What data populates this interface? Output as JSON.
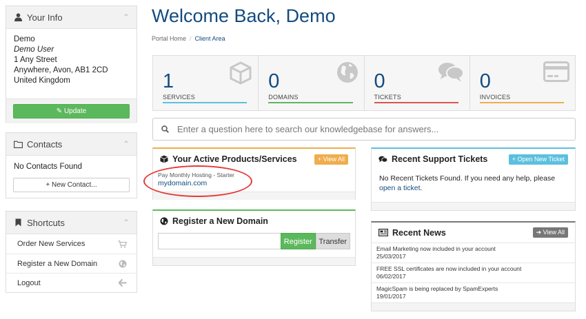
{
  "your_info": {
    "title": "Your Info",
    "name": "Demo",
    "user": "Demo User",
    "address1": "1 Any Street",
    "address2": "Anywhere, Avon, AB1 2CD",
    "country": "United Kingdom",
    "update_label": "Update"
  },
  "contacts": {
    "title": "Contacts",
    "empty_text": "No Contacts Found",
    "new_label": "New Contact..."
  },
  "shortcuts": {
    "title": "Shortcuts",
    "items": [
      {
        "label": "Order New Services",
        "icon": "cart-icon"
      },
      {
        "label": "Register a New Domain",
        "icon": "globe-icon"
      },
      {
        "label": "Logout",
        "icon": "arrow-left-icon"
      }
    ]
  },
  "page": {
    "title": "Welcome Back, Demo",
    "breadcrumb": [
      "Portal Home",
      "Client Area"
    ]
  },
  "stats": [
    {
      "value": "1",
      "label": "SERVICES",
      "color": "#5bc0de",
      "icon": "cube-icon"
    },
    {
      "value": "0",
      "label": "DOMAINS",
      "color": "#5cb85c",
      "icon": "globe-icon"
    },
    {
      "value": "0",
      "label": "TICKETS",
      "color": "#d9534f",
      "icon": "comments-icon"
    },
    {
      "value": "0",
      "label": "INVOICES",
      "color": "#f0ad4e",
      "icon": "credit-card-icon"
    }
  ],
  "search": {
    "placeholder": "Enter a question here to search our knowledgebase for answers..."
  },
  "products": {
    "title": "Your Active Products/Services",
    "view_all": "View All",
    "accent": "#f0ad4e",
    "item_name": "Pay Monthly Hosting - Starter",
    "item_domain": "mydomain.com"
  },
  "register_domain": {
    "title": "Register a New Domain",
    "accent": "#5cb85c",
    "register_label": "Register",
    "transfer_label": "Transfer"
  },
  "support": {
    "title": "Recent Support Tickets",
    "button": "Open New Ticket",
    "accent": "#5bc0de",
    "text": "No Recent Tickets Found. If you need any help, please",
    "link": "open a ticket",
    "end": "."
  },
  "news": {
    "title": "Recent News",
    "view_all": "View All",
    "accent": "#777777",
    "items": [
      {
        "title": "Email Marketing now included in your account",
        "date": "25/03/2017"
      },
      {
        "title": "FREE SSL certificates are now included in your account",
        "date": "06/02/2017"
      },
      {
        "title": "MagicSpam is being replaced by SpamExperts",
        "date": "19/01/2017"
      }
    ]
  }
}
